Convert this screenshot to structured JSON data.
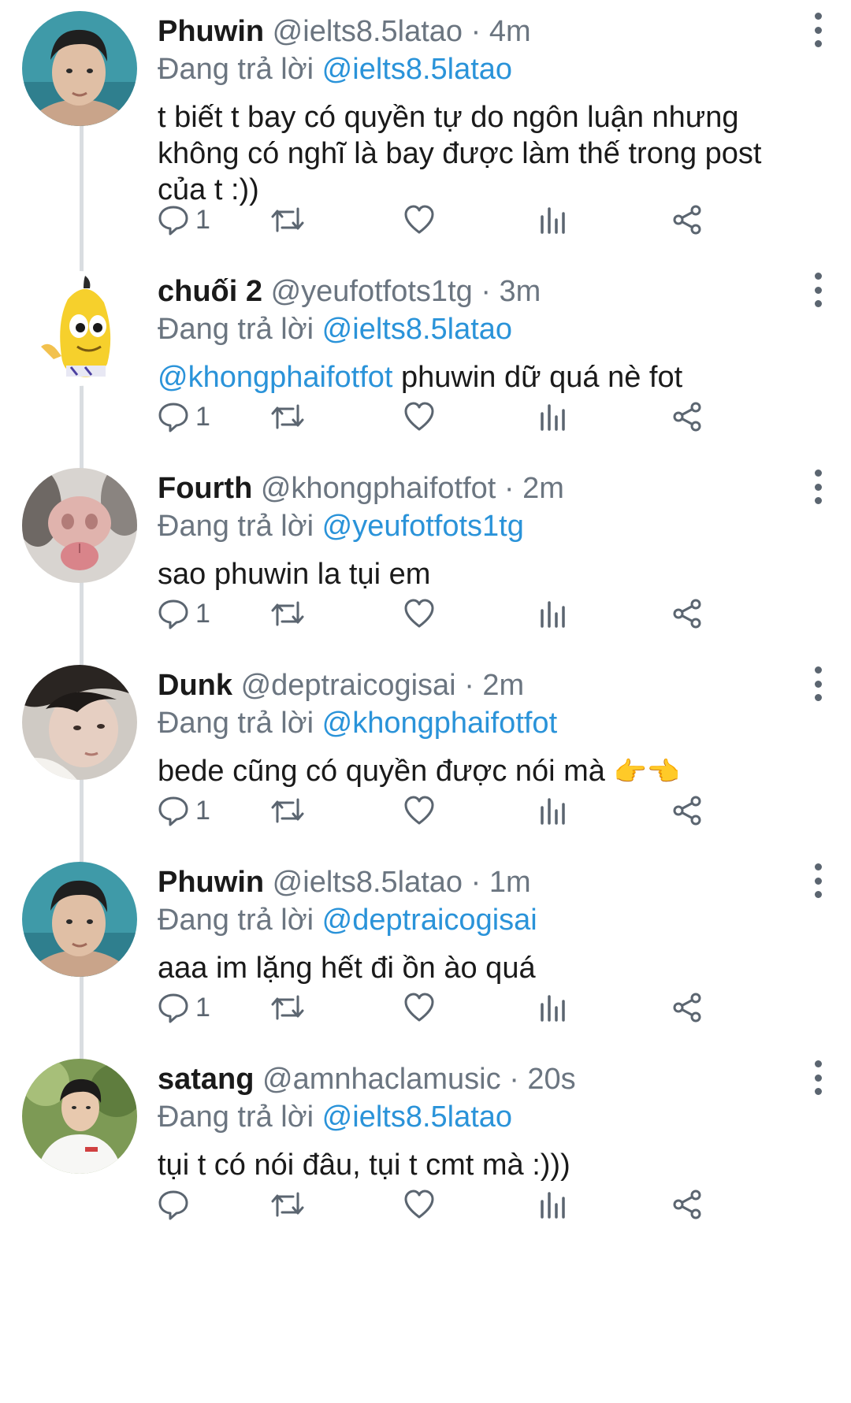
{
  "reply_prefix": "Đang trả lời",
  "colors": {
    "mention": "#2a93d9",
    "muted": "#6b7580",
    "thread_line": "#d9dde1"
  },
  "icons": [
    "reply-icon",
    "retweet-icon",
    "like-icon",
    "views-icon",
    "share-icon",
    "more-icon"
  ],
  "tweets": [
    {
      "name": "Phuwin",
      "handle": "@ielts8.5latao",
      "sep": "·",
      "time": "4m",
      "reply_to": "@ielts8.5latao",
      "text_mention": "",
      "text": "t biết t bay có quyền tự do ngôn luận nhưng không có nghĩ là bay được làm thế trong post của t :))",
      "reply_count": "1"
    },
    {
      "name": "chuối 2",
      "handle": "@yeufotfots1tg",
      "sep": "·",
      "time": "3m",
      "reply_to": "@ielts8.5latao",
      "text_mention": "@khongphaifotfot",
      "text": " phuwin dữ quá nè fot",
      "reply_count": "1"
    },
    {
      "name": "Fourth",
      "handle": "@khongphaifotfot",
      "sep": "·",
      "time": "2m",
      "reply_to": "@yeufotfots1tg",
      "text_mention": "",
      "text": "sao phuwin la tụi em",
      "reply_count": "1"
    },
    {
      "name": "Dunk",
      "handle": "@deptraicogisai",
      "sep": "·",
      "time": "2m",
      "reply_to": "@khongphaifotfot",
      "text_mention": "",
      "text": "bede cũng có quyền được nói mà ",
      "emoji": "👉👈",
      "reply_count": "1"
    },
    {
      "name": "Phuwin",
      "handle": "@ielts8.5latao",
      "sep": "·",
      "time": "1m",
      "reply_to": "@deptraicogisai",
      "text_mention": "",
      "text": "aaa im lặng hết đi ồn ào quá",
      "reply_count": "1"
    },
    {
      "name": "satang",
      "handle": "@amnhaclamusic",
      "sep": "·",
      "time": "20s",
      "reply_to": "@ielts8.5latao",
      "text_mention": "",
      "text": "tụi t có nói đâu, tụi t cmt mà :)))",
      "reply_count": ""
    }
  ]
}
